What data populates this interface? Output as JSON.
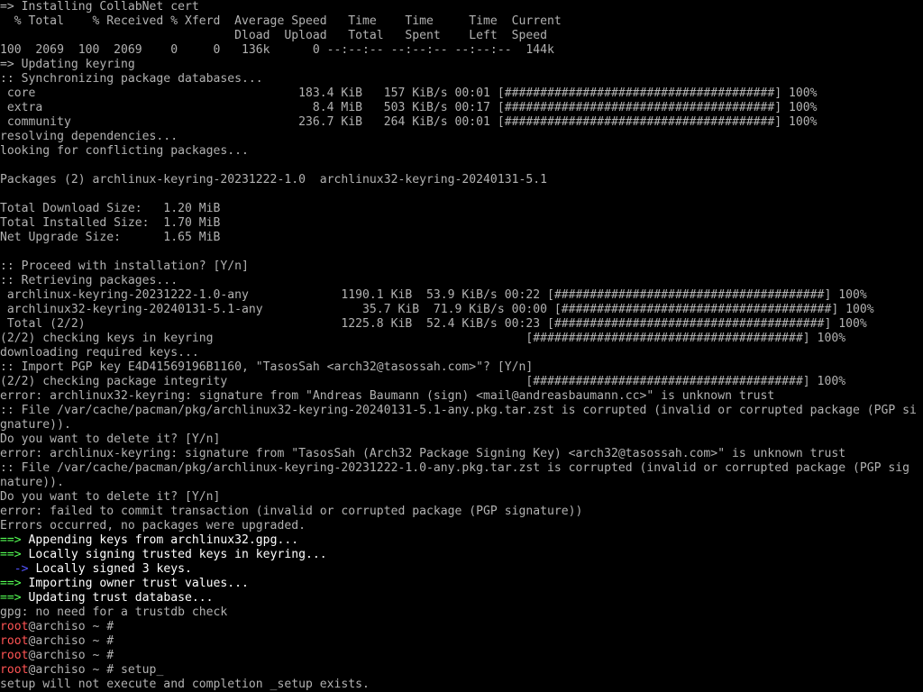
{
  "colors": {
    "background": "#000000",
    "text": "#b2b2b2",
    "bright": "#ffffff",
    "green_arrow": "#54ff54",
    "blue_arrow": "#5454ff",
    "prompt_user": "#ff5454"
  },
  "terminal": {
    "lines": [
      [
        {
          "t": "=> Installing CollabNet cert"
        }
      ],
      [
        {
          "t": "  % Total    % Received % Xferd  Average Speed   Time    Time     Time  Current"
        }
      ],
      [
        {
          "t": "                                 Dload  Upload   Total   Spent    Left  Speed"
        }
      ],
      [
        {
          "t": "100  2069  100  2069    0     0   136k      0 --:--:-- --:--:-- --:--:--  144k"
        }
      ],
      [
        {
          "t": "=> Updating keyring"
        }
      ],
      [
        {
          "t": ":: Synchronizing package databases..."
        }
      ],
      [
        {
          "t": " core                                     183.4 KiB   157 KiB/s 00:01 [######################################] 100%"
        }
      ],
      [
        {
          "t": " extra                                      8.4 MiB   503 KiB/s 00:17 [######################################] 100%"
        }
      ],
      [
        {
          "t": " community                                236.7 KiB   264 KiB/s 00:01 [######################################] 100%"
        }
      ],
      [
        {
          "t": "resolving dependencies..."
        }
      ],
      [
        {
          "t": "looking for conflicting packages..."
        }
      ],
      [
        {
          "t": ""
        }
      ],
      [
        {
          "t": "Packages (2) archlinux-keyring-20231222-1.0  archlinux32-keyring-20240131-5.1"
        }
      ],
      [
        {
          "t": ""
        }
      ],
      [
        {
          "t": "Total Download Size:   1.20 MiB"
        }
      ],
      [
        {
          "t": "Total Installed Size:  1.70 MiB"
        }
      ],
      [
        {
          "t": "Net Upgrade Size:      1.65 MiB"
        }
      ],
      [
        {
          "t": ""
        }
      ],
      [
        {
          "t": ":: Proceed with installation? [Y/n]"
        }
      ],
      [
        {
          "t": ":: Retrieving packages..."
        }
      ],
      [
        {
          "t": " archlinux-keyring-20231222-1.0-any             1190.1 KiB  53.9 KiB/s 00:22 [######################################] 100%"
        }
      ],
      [
        {
          "t": " archlinux32-keyring-20240131-5.1-any              35.7 KiB  71.9 KiB/s 00:00 [######################################] 100%"
        }
      ],
      [
        {
          "t": " Total (2/2)                                    1225.8 KiB  52.4 KiB/s 00:23 [######################################] 100%"
        }
      ],
      [
        {
          "t": "(2/2) checking keys in keyring                                            [######################################] 100%"
        }
      ],
      [
        {
          "t": "downloading required keys..."
        }
      ],
      [
        {
          "t": ":: Import PGP key E4D41569196B1160, \"TasosSah <arch32@tasossah.com>\"? [Y/n]"
        }
      ],
      [
        {
          "t": "(2/2) checking package integrity                                          [######################################] 100%"
        }
      ],
      [
        {
          "t": "error: archlinux32-keyring: signature from \"Andreas Baumann (sign) <mail@andreasbaumann.cc>\" is unknown trust"
        }
      ],
      [
        {
          "t": ":: File /var/cache/pacman/pkg/archlinux32-keyring-20240131-5.1-any.pkg.tar.zst is corrupted (invalid or corrupted package (PGP si"
        }
      ],
      [
        {
          "t": "gnature))."
        }
      ],
      [
        {
          "t": "Do you want to delete it? [Y/n]"
        }
      ],
      [
        {
          "t": "error: archlinux-keyring: signature from \"TasosSah (Arch32 Package Signing Key) <arch32@tasossah.com>\" is unknown trust"
        }
      ],
      [
        {
          "t": ":: File /var/cache/pacman/pkg/archlinux-keyring-20231222-1.0-any.pkg.tar.zst is corrupted (invalid or corrupted package (PGP sig"
        }
      ],
      [
        {
          "t": "nature))."
        }
      ],
      [
        {
          "t": "Do you want to delete it? [Y/n]"
        }
      ],
      [
        {
          "t": "error: failed to commit transaction (invalid or corrupted package (PGP signature))"
        }
      ],
      [
        {
          "t": "Errors occurred, no packages were upgraded."
        }
      ],
      [
        {
          "t": "==>",
          "c": "green"
        },
        {
          "t": " Appending keys from archlinux32.gpg...",
          "c": "bright"
        }
      ],
      [
        {
          "t": "==>",
          "c": "green"
        },
        {
          "t": " Locally signing trusted keys in keyring...",
          "c": "bright"
        }
      ],
      [
        {
          "t": "  "
        },
        {
          "t": "->",
          "c": "blue"
        },
        {
          "t": " Locally signed 3 keys.",
          "c": "bright"
        }
      ],
      [
        {
          "t": "==>",
          "c": "green"
        },
        {
          "t": " Importing owner trust values...",
          "c": "bright"
        }
      ],
      [
        {
          "t": "==>",
          "c": "green"
        },
        {
          "t": " Updating trust database...",
          "c": "bright"
        }
      ],
      [
        {
          "t": "gpg: no need for a trustdb check"
        }
      ],
      [
        {
          "t": "root",
          "c": "red"
        },
        {
          "t": "@archiso ~ #"
        }
      ],
      [
        {
          "t": "root",
          "c": "red"
        },
        {
          "t": "@archiso ~ #"
        }
      ],
      [
        {
          "t": "root",
          "c": "red"
        },
        {
          "t": "@archiso ~ #"
        }
      ],
      [
        {
          "t": "root",
          "c": "red"
        },
        {
          "t": "@archiso ~ # setup_"
        }
      ],
      [
        {
          "t": "setup will not execute and completion _setup exists."
        }
      ]
    ]
  }
}
